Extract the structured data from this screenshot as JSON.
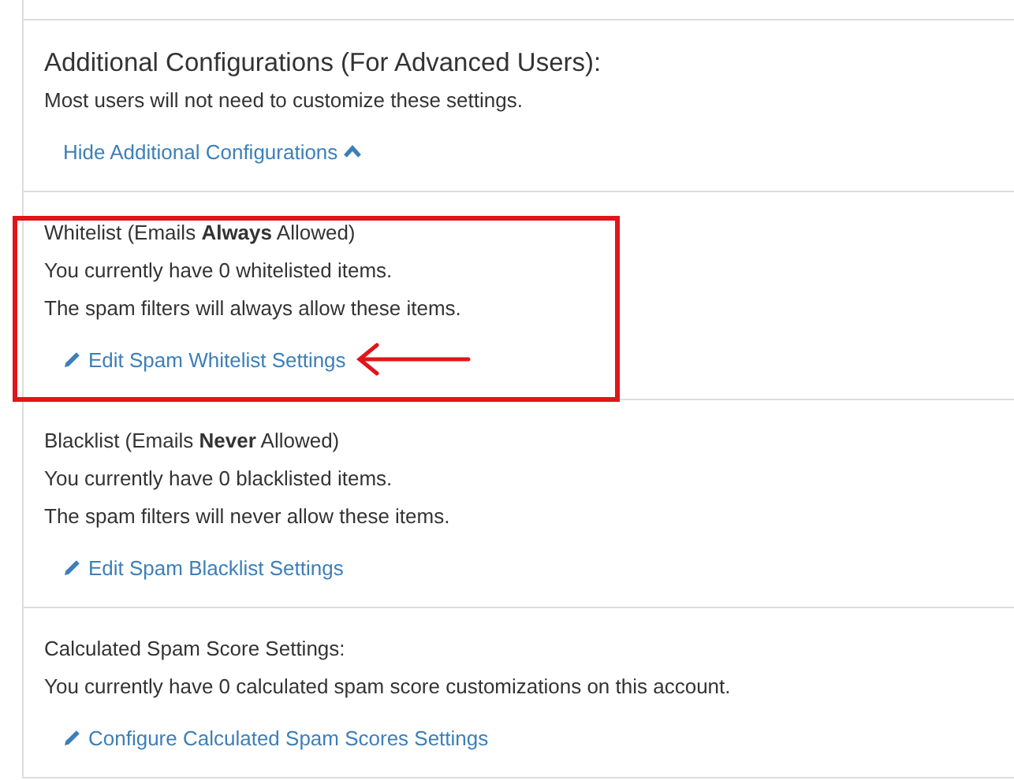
{
  "top_section": {
    "title": "Additional Configurations (For Advanced Users):",
    "description": "Most users will not need to customize these settings.",
    "toggle_link": {
      "label": "Hide Additional Configurations",
      "expanded": true
    }
  },
  "sections": [
    {
      "heading": "Whitelist (Emails **Always** Allowed)",
      "lines": [
        "You currently have 0 whitelisted items.",
        "The spam filters will always allow these items."
      ],
      "link": "Edit Spam Whitelist Settings",
      "highlighted": true
    },
    {
      "heading": "Blacklist (Emails **Never** Allowed)",
      "lines": [
        "You currently have 0 blacklisted items.",
        "The spam filters will never allow these items."
      ],
      "link": "Edit Spam Blacklist Settings",
      "highlighted": false
    },
    {
      "heading": "Calculated Spam Score Settings:",
      "lines": [
        "You currently have 0 calculated spam score customizations on this account."
      ],
      "link": "Configure Calculated Spam Scores Settings",
      "highlighted": false
    }
  ]
}
